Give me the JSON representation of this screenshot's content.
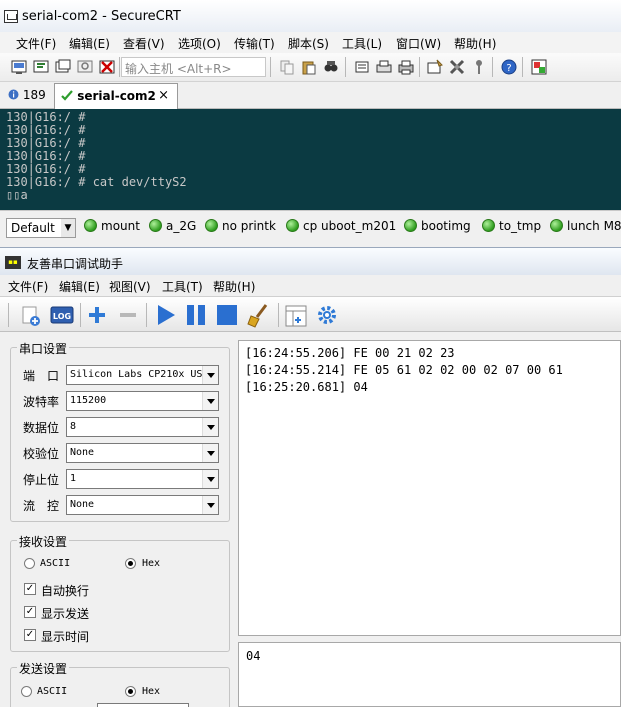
{
  "securecrt": {
    "title": "serial-com2 - SecureCRT",
    "menu": [
      "文件(F)",
      "编辑(E)",
      "查看(V)",
      "选项(O)",
      "传输(T)",
      "脚本(S)",
      "工具(L)",
      "窗口(W)",
      "帮助(H)"
    ],
    "host_placeholder": "输入主机 <Alt+R>",
    "tabs": [
      {
        "label": "189",
        "active": false
      },
      {
        "label": "serial-com2",
        "active": true
      }
    ],
    "tab_close": "×",
    "terminal_lines": [
      "130|G16:/ #",
      "130|G16:/ #",
      "130|G16:/ #",
      "130|G16:/ #",
      "130|G16:/ #",
      "130|G16:/ # cat dev/ttyS2",
      "▯▯a"
    ],
    "button_bar": {
      "default_label": "Default",
      "buttons": [
        "mount",
        "a_2G",
        "no printk",
        "cp uboot_m201",
        "bootimg",
        "to_tmp",
        "lunch M8"
      ]
    },
    "colors": {
      "terminal_bg": "#0b3a42",
      "terminal_fg": "#c7c7c7"
    }
  },
  "serial_tool": {
    "title": "友善串口调试助手",
    "menu": [
      "文件(F)",
      "编辑(E)",
      "视图(V)",
      "工具(T)",
      "帮助(H)"
    ],
    "port_settings": {
      "label": "串口设置",
      "rows": [
        {
          "label": "端　口",
          "value": "Silicon Labs CP210x US"
        },
        {
          "label": "波特率",
          "value": "115200"
        },
        {
          "label": "数据位",
          "value": "8"
        },
        {
          "label": "校验位",
          "value": "None"
        },
        {
          "label": "停止位",
          "value": "1"
        },
        {
          "label": "流　控",
          "value": "None"
        }
      ]
    },
    "receive_settings": {
      "label": "接收设置",
      "ascii": "ASCII",
      "hex": "Hex",
      "selected": "Hex",
      "options": [
        {
          "label": "自动换行",
          "checked": true
        },
        {
          "label": "显示发送",
          "checked": true
        },
        {
          "label": "显示时间",
          "checked": true
        }
      ]
    },
    "send_settings": {
      "label": "发送设置",
      "ascii": "ASCII",
      "hex": "Hex",
      "selected": "Hex"
    },
    "receive_lines": [
      "[16:24:55.206] FE 00 21 02 23",
      "[16:24:55.214] FE 05 61 02 02 00 02 07 00 61",
      "[16:25:20.681] 04"
    ],
    "send_text": "04"
  }
}
